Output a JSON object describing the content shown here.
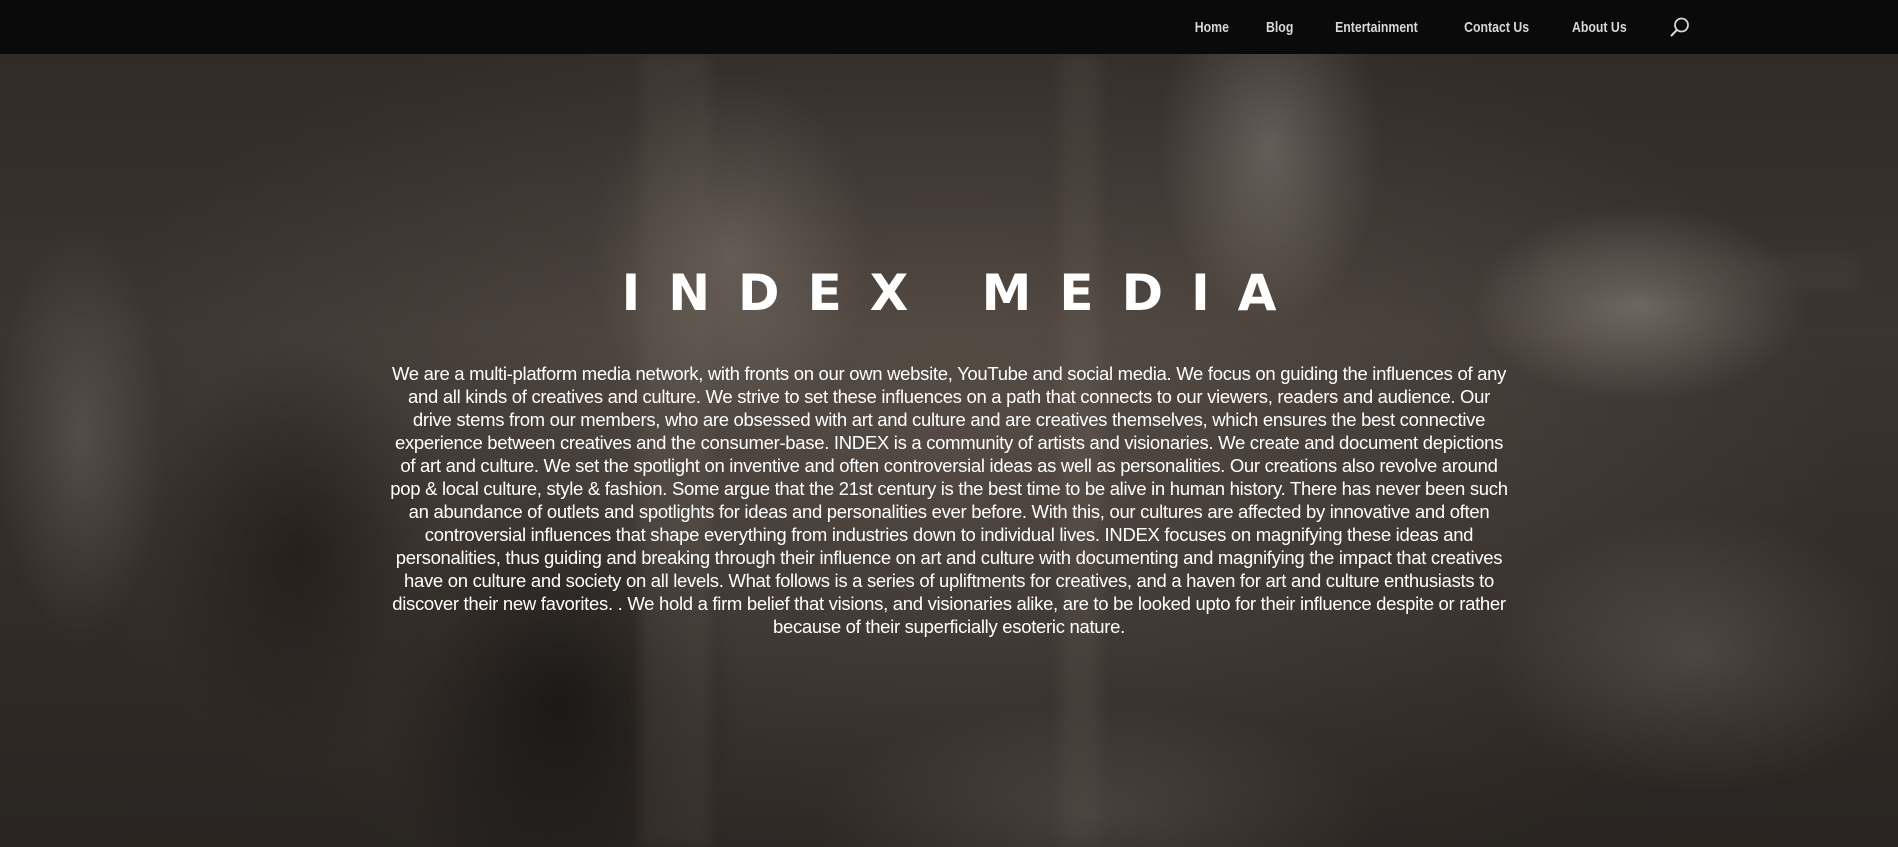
{
  "nav": {
    "items": [
      {
        "label": "Home"
      },
      {
        "label": "Blog"
      },
      {
        "label": "Entertainment"
      },
      {
        "label": "Contact Us"
      },
      {
        "label": "About Us"
      }
    ],
    "search_icon": "search-icon"
  },
  "hero": {
    "title": "INDEX MEDIA",
    "description": "We are a multi-platform media network, with fronts on our own website, YouTube and social media. We focus on guiding the influences of any and all kinds of creatives and culture. We strive to set these influences on a path that connects to our viewers, readers and audience. Our drive stems from our members, who are obsessed with art and culture and are creatives themselves, which ensures the best connective experience between creatives and the consumer-base. INDEX is a community of artists and visionaries. We create and document depictions of art and culture. We set the spotlight on inventive and often controversial ideas as well as personalities. Our creations also revolve around pop & local culture, style & fashion. Some argue that the 21st century is the best time to be alive in human history. There has never been such an abundance of outlets and spotlights for ideas and personalities ever before. With this, our cultures are affected by innovative and often controversial influences that shape everything from industries down to individual lives. INDEX focuses on magnifying these ideas and personalities, thus guiding and breaking through their influence on art and culture with documenting and magnifying the impact that creatives have on culture and society on all levels. What follows is a series of upliftments for creatives, and a haven for art and culture enthusiasts to discover their new favorites. . We hold a firm belief that visions, and visionaries alike, are to be looked upto for their influence despite or rather because of their superficially esoteric nature."
  },
  "colors": {
    "topbar": "#0a0a0a",
    "nav_text": "#d8d8d8",
    "hero_text": "#ffffff"
  }
}
